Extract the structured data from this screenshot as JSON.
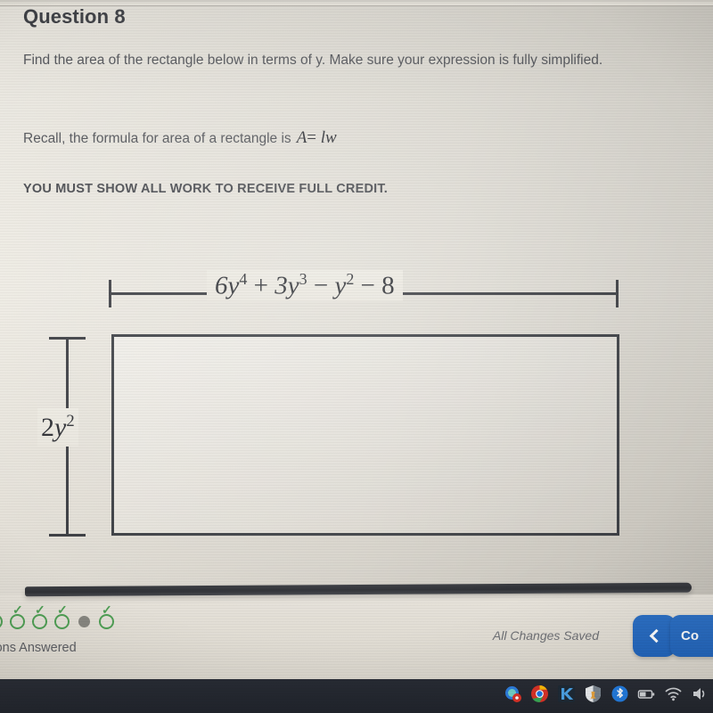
{
  "question": {
    "title": "Question 8",
    "prompt": "Find the area of the rectangle below in terms of y. Make sure your expression is fully simplified.",
    "recall_text": "Recall, the formula for area of a rectangle is",
    "formula_A": "A",
    "formula_eq": "=",
    "formula_lw": "lw",
    "credit_notice": "YOU MUST SHOW ALL WORK TO RECEIVE FULL CREDIT."
  },
  "figure": {
    "shape": "rectangle",
    "width_label_plain": "6y^4 + 3y^3 - y^2 - 8",
    "width_label_parts": {
      "coef6": "6",
      "var_y1": "y",
      "exp4": "4",
      "plus": " + ",
      "coef3": "3",
      "var_y2": "y",
      "exp3": "3",
      "minus1": " − ",
      "var_y3": "y",
      "exp2": "2",
      "minus2": " − ",
      "const8": "8"
    },
    "height_label_plain": "2y^2",
    "height_label_parts": {
      "coef2": "2",
      "var_y": "y",
      "exp2": "2"
    }
  },
  "footer": {
    "progress_dots": [
      {
        "state": "answered",
        "icon": "check-icon"
      },
      {
        "state": "answered",
        "icon": "check-icon"
      },
      {
        "state": "answered",
        "icon": "check-icon"
      },
      {
        "state": "answered",
        "icon": "check-icon"
      },
      {
        "state": "current",
        "icon": "filled-dot-icon"
      },
      {
        "state": "answered",
        "icon": "check-icon"
      }
    ],
    "answered_label": "estions Answered",
    "saved_status": "All Changes Saved",
    "back_button_label": "",
    "back_button_icon": "chevron-left-icon",
    "continue_button_label": "Co",
    "accent_color": "#1f63bb",
    "progress_green": "#4e9e54",
    "current_dot_gray": "#86857f"
  },
  "taskbar": {
    "icons": [
      {
        "name": "messages-icon",
        "glyph": "●"
      },
      {
        "name": "chrome-icon",
        "glyph": "●"
      },
      {
        "name": "k-app-icon",
        "glyph": "K"
      },
      {
        "name": "shield-app-icon",
        "glyph": "◑"
      },
      {
        "name": "bluetooth-icon",
        "glyph": "ᛦ"
      },
      {
        "name": "battery-icon",
        "glyph": "▭"
      },
      {
        "name": "wifi-icon",
        "glyph": "◠"
      },
      {
        "name": "volume-icon",
        "glyph": "◀"
      }
    ],
    "background_color": "#1e222a"
  }
}
